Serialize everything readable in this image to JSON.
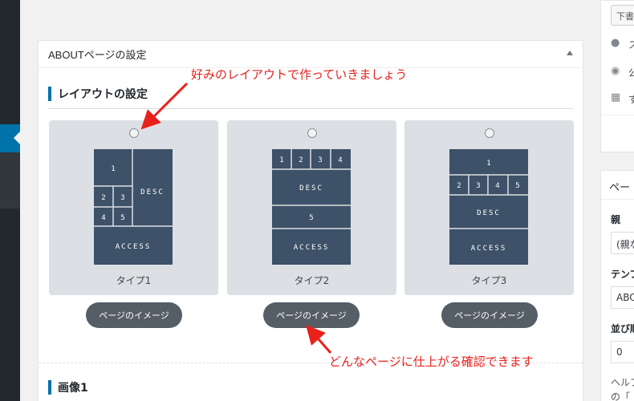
{
  "metabox": {
    "title": "ABOUTページの設定",
    "layout_heading": "レイアウトの設定",
    "image_heading": "画像1",
    "layouts": [
      {
        "label": "タイプ1",
        "button": "ページのイメージ"
      },
      {
        "label": "タイプ2",
        "button": "ページのイメージ"
      },
      {
        "label": "タイプ3",
        "button": "ページのイメージ"
      }
    ],
    "diagram_labels": {
      "one": "1",
      "two": "2",
      "three": "3",
      "four": "4",
      "five": "5",
      "desc": "DESC",
      "access": "ACCESS"
    },
    "colors": {
      "block": "#3d5168",
      "card": "#dcdfe3",
      "button": "#555d66",
      "heading_bar": "#0073aa"
    }
  },
  "annotations": {
    "top": "好みのレイアウトで作っていきましょう",
    "bottom": "どんなページに仕上がる確認できます",
    "color": "#e8211c"
  },
  "sidebar": {
    "draft_button": "下書",
    "status_text": "ス",
    "visibility_text": "公",
    "schedule_text": "す",
    "attributes_title": "ペー",
    "parent_label": "親",
    "parent_value": "(親な",
    "template_label": "テンプ",
    "template_value": "ABO",
    "order_label": "並び順",
    "order_value": "0",
    "help_line1": "ヘルプ",
    "help_line2": "の「"
  }
}
